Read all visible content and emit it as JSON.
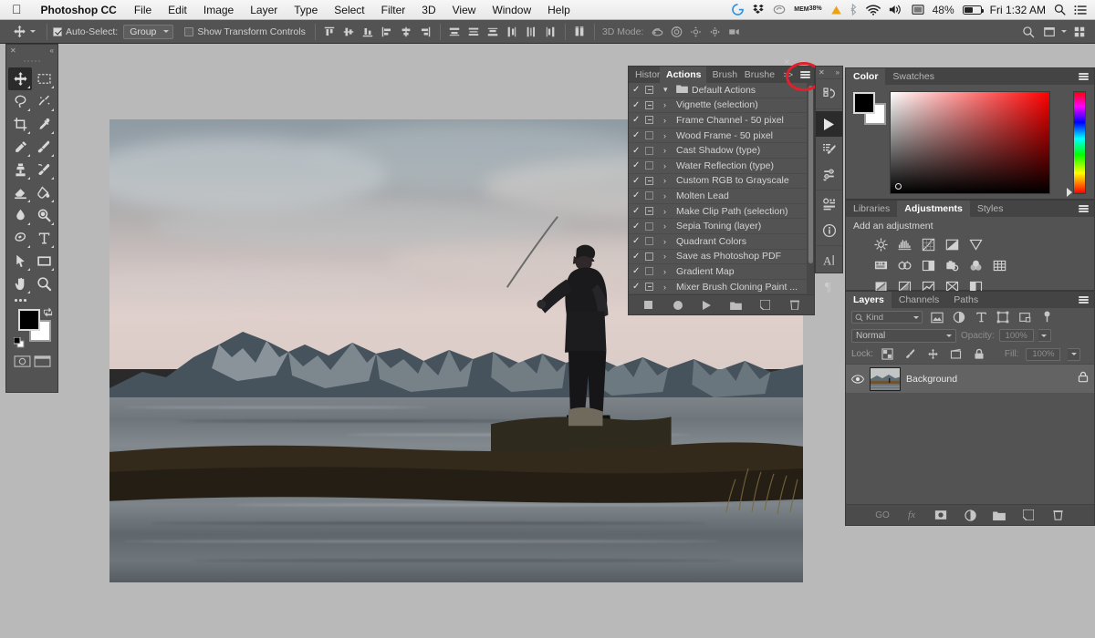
{
  "menubar": {
    "apple": "apple-logo",
    "app_name": "Photoshop CC",
    "items": [
      "File",
      "Edit",
      "Image",
      "Layer",
      "Type",
      "Select",
      "Filter",
      "3D",
      "View",
      "Window",
      "Help"
    ],
    "status": {
      "memory_label": "MEM",
      "memory_value": "38%",
      "battery_percent": "48%",
      "time": "Fri 1:32 AM",
      "icons": [
        "grammarly-icon",
        "dropbox-icon",
        "creative-cloud-icon",
        "memory-icon",
        "warning-icon",
        "bluetooth-icon",
        "wifi-icon",
        "volume-icon",
        "display-icon",
        "battery-icon",
        "spotlight-search-icon",
        "notification-center-icon"
      ]
    }
  },
  "options_bar": {
    "tool_icon": "move-tool-icon",
    "auto_select_label": "Auto-Select:",
    "auto_select_checked": true,
    "auto_select_value": "Group",
    "show_transform_label": "Show Transform Controls",
    "show_transform_checked": false,
    "align_icons": [
      "align-top-edges-icon",
      "align-vertical-centers-icon",
      "align-bottom-edges-icon",
      "align-left-edges-icon",
      "align-horizontal-centers-icon",
      "align-right-edges-icon"
    ],
    "distribute_icons": [
      "distribute-top-edges-icon",
      "distribute-vertical-centers-icon",
      "distribute-bottom-edges-icon",
      "distribute-left-edges-icon",
      "distribute-horizontal-centers-icon",
      "distribute-right-edges-icon"
    ],
    "extra_icon": "auto-align-layers-icon",
    "mode_3d_label": "3D Mode:",
    "mode_3d_icons": [
      "rotate-3d-object-icon",
      "roll-3d-object-icon",
      "drag-3d-object-icon",
      "slide-3d-object-icon",
      "scale-3d-object-icon"
    ],
    "right_icons": [
      "search-icon",
      "arrange-documents-icon",
      "workspace-switcher-icon"
    ]
  },
  "toolbar": {
    "close_icon": "close-icon",
    "collapse_icon": "double-chevron-left-icon",
    "tools": [
      {
        "name": "move-tool",
        "selected": true
      },
      {
        "name": "rectangular-marquee-tool",
        "selected": false
      },
      {
        "name": "lasso-tool",
        "selected": false
      },
      {
        "name": "quick-selection-tool",
        "selected": false
      },
      {
        "name": "crop-tool",
        "selected": false
      },
      {
        "name": "eyedropper-tool",
        "selected": false
      },
      {
        "name": "spot-healing-brush-tool",
        "selected": false
      },
      {
        "name": "brush-tool",
        "selected": false
      },
      {
        "name": "clone-stamp-tool",
        "selected": false
      },
      {
        "name": "history-brush-tool",
        "selected": false
      },
      {
        "name": "eraser-tool",
        "selected": false
      },
      {
        "name": "gradient-tool",
        "selected": false
      },
      {
        "name": "blur-tool",
        "selected": false
      },
      {
        "name": "dodge-tool",
        "selected": false
      },
      {
        "name": "pen-tool",
        "selected": false
      },
      {
        "name": "horizontal-type-tool",
        "selected": false
      },
      {
        "name": "path-selection-tool",
        "selected": false
      },
      {
        "name": "rectangle-tool",
        "selected": false
      },
      {
        "name": "hand-tool",
        "selected": false
      },
      {
        "name": "zoom-tool",
        "selected": false
      }
    ],
    "more_tools_icon": "more-tools-icon",
    "foreground_color": "#000000",
    "background_color": "#ffffff",
    "swap_icon": "swap-colors-icon",
    "default_colors_icon": "default-colors-icon",
    "quick_mask_icon": "quick-mask-mode-icon",
    "screen_mode_icon": "screen-mode-icon"
  },
  "actions_panel": {
    "tabs": [
      {
        "label": "History",
        "active": false
      },
      {
        "label": "Actions",
        "active": true
      },
      {
        "label": "Brush",
        "active": false
      },
      {
        "label": "Brushe",
        "active": false
      }
    ],
    "overflow_label": ">>",
    "menu_icon": "panel-menu-icon",
    "close_icon": "close-icon",
    "collapse_icon": "double-chevron-right-icon",
    "set_name": "Default Actions",
    "items": [
      {
        "label": "Default Actions",
        "checked": true,
        "box": "dash",
        "is_set": true
      },
      {
        "label": "Vignette (selection)",
        "checked": true,
        "box": "dash",
        "is_set": false
      },
      {
        "label": "Frame Channel - 50 pixel",
        "checked": true,
        "box": "dash",
        "is_set": false
      },
      {
        "label": "Wood Frame - 50 pixel",
        "checked": true,
        "box": "empty",
        "is_set": false
      },
      {
        "label": "Cast Shadow (type)",
        "checked": true,
        "box": "empty",
        "is_set": false
      },
      {
        "label": "Water Reflection (type)",
        "checked": true,
        "box": "empty",
        "is_set": false
      },
      {
        "label": "Custom RGB to Grayscale",
        "checked": true,
        "box": "dash",
        "is_set": false
      },
      {
        "label": "Molten Lead",
        "checked": true,
        "box": "empty",
        "is_set": false
      },
      {
        "label": "Make Clip Path (selection)",
        "checked": true,
        "box": "dash",
        "is_set": false
      },
      {
        "label": "Sepia Toning (layer)",
        "checked": true,
        "box": "empty",
        "is_set": false
      },
      {
        "label": "Quadrant Colors",
        "checked": true,
        "box": "empty",
        "is_set": false
      },
      {
        "label": "Save as Photoshop PDF",
        "checked": true,
        "box": "outline",
        "is_set": false
      },
      {
        "label": "Gradient Map",
        "checked": true,
        "box": "empty",
        "is_set": false
      },
      {
        "label": "Mixer Brush Cloning Paint ...",
        "checked": true,
        "box": "dash",
        "is_set": false
      }
    ],
    "footer_icons": [
      "stop-playing-icon",
      "begin-recording-icon",
      "play-selection-icon",
      "create-new-set-icon",
      "create-new-action-icon",
      "delete-icon"
    ]
  },
  "annotation": {
    "shape": "red-circle-highlight",
    "color": "#e0212b",
    "target": "actions-panel-menu-button"
  },
  "icon_dock": {
    "close_icon": "close-icon",
    "collapse_icon": "double-chevron-right-icon",
    "groups": [
      [
        "history-panel-icon"
      ],
      [
        "actions-panel-icon",
        "brush-panel-icon",
        "brush-presets-panel-icon"
      ],
      [
        "properties-panel-icon",
        "info-panel-icon"
      ],
      [
        "character-panel-icon",
        "paragraph-panel-icon"
      ]
    ]
  },
  "color_panel": {
    "tabs": [
      {
        "label": "Color",
        "active": true
      },
      {
        "label": "Swatches",
        "active": false
      }
    ],
    "menu_icon": "panel-menu-icon",
    "foreground_color": "#000000",
    "background_color": "#ffffff",
    "field_hue_color": "#ff0000",
    "picker_icon": "color-picker-handle",
    "hue_slider_icon": "hue-slider"
  },
  "adjustments_panel": {
    "tabs": [
      {
        "label": "Libraries",
        "active": false
      },
      {
        "label": "Adjustments",
        "active": true
      },
      {
        "label": "Styles",
        "active": false
      }
    ],
    "menu_icon": "panel-menu-icon",
    "title": "Add an adjustment",
    "rows": [
      [
        "brightness-contrast-icon",
        "levels-icon",
        "curves-icon",
        "exposure-icon",
        "vibrance-icon"
      ],
      [
        "hue-saturation-icon",
        "color-balance-icon",
        "black-white-icon",
        "photo-filter-icon",
        "channel-mixer-icon",
        "color-lookup-icon"
      ],
      [
        "invert-icon",
        "posterize-icon",
        "threshold-icon",
        "gradient-map-icon",
        "selective-color-icon"
      ]
    ]
  },
  "layers_panel": {
    "tabs": [
      {
        "label": "Layers",
        "active": true
      },
      {
        "label": "Channels",
        "active": false
      },
      {
        "label": "Paths",
        "active": false
      }
    ],
    "menu_icon": "panel-menu-icon",
    "filter_label": "Kind",
    "filter_icon": "search-icon",
    "filter_type_icons": [
      "filter-pixel-icon",
      "filter-adjustment-icon",
      "filter-type-icon",
      "filter-shape-icon",
      "filter-smart-object-icon"
    ],
    "filter_toggle_icon": "filter-toggle-icon",
    "blend_mode": "Normal",
    "opacity_label": "Opacity:",
    "opacity_value": "100%",
    "lock_label": "Lock:",
    "lock_icons": [
      "lock-transparent-pixels-icon",
      "lock-image-pixels-icon",
      "lock-position-icon",
      "lock-artboard-nesting-icon",
      "lock-all-icon"
    ],
    "fill_label": "Fill:",
    "fill_value": "100%",
    "layers": [
      {
        "name": "Background",
        "visible": true,
        "locked": true,
        "visibility_icon": "eye-icon",
        "lock_icon": "lock-icon",
        "thumbnail": "layer-thumbnail"
      }
    ],
    "footer_icons": [
      "link-layers-icon",
      "layer-style-icon",
      "layer-mask-icon",
      "new-fill-adjustment-icon",
      "new-group-icon",
      "new-layer-icon",
      "delete-layer-icon"
    ],
    "footer_labels": [
      "GO",
      "fx"
    ]
  },
  "canvas": {
    "document_name": "landscape-photograph",
    "description": "fly fisherman casting on riverbank with snow-capped mountains at sunset"
  }
}
